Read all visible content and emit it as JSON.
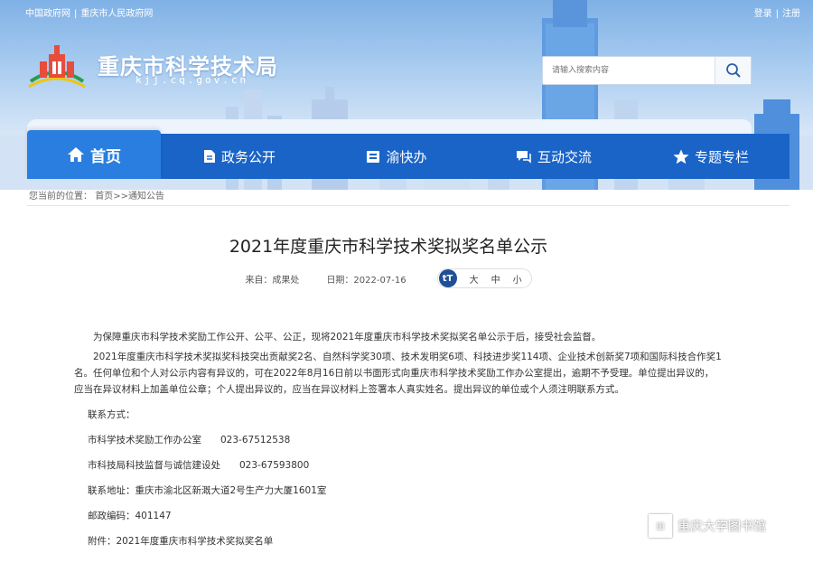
{
  "top_links": {
    "left": [
      "中国政府网",
      "重庆市人民政府网"
    ],
    "login": "登录",
    "register": "注册"
  },
  "site": {
    "title": "重庆市科学技术局",
    "domain": "kjj.cq.gov.cn"
  },
  "search": {
    "placeholder": "请输入搜索内容",
    "button_icon": "search-icon"
  },
  "nav": [
    {
      "label": "首页",
      "icon": "home-icon"
    },
    {
      "label": "政务公开",
      "icon": "document-icon"
    },
    {
      "label": "渝快办",
      "icon": "folder-icon"
    },
    {
      "label": "互动交流",
      "icon": "chat-icon"
    },
    {
      "label": "专题专栏",
      "icon": "star-icon"
    }
  ],
  "breadcrumb": {
    "prefix": "您当前的位置：",
    "home": "首页",
    "separator": ">>",
    "current": "通知公告"
  },
  "article": {
    "title": "2021年度重庆市科学技术奖拟奖名单公示",
    "source": "来自：成果处",
    "date": "日期：2022-07-16",
    "fontsize_icon": "tT",
    "fontsize_options": [
      "大",
      "中",
      "小"
    ],
    "paragraphs": [
      "为保障重庆市科学技术奖励工作公开、公平、公正，现将2021年度重庆市科学技术奖拟奖名单公示于后，接受社会监督。",
      "2021年度重庆市科学技术奖拟奖科技突出贡献奖2名、自然科学奖30项、技术发明奖6项、科技进步奖114项、企业技术创新奖7项和国际科技合作奖1名。任何单位和个人对公示内容有异议的，可在2022年8月16日前以书面形式向重庆市科学技术奖励工作办公室提出，逾期不予受理。单位提出异议的，应当在异议材料上加盖单位公章；个人提出异议的，应当在异议材料上签署本人真实姓名。提出异议的单位或个人须注明联系方式。"
    ],
    "contact_label": "联系方式：",
    "contacts": [
      "市科学技术奖励工作办公室　　023-67512538",
      "市科技局科技监督与诚信建设处　　023-67593800"
    ],
    "address": "联系地址：重庆市渝北区新溉大道2号生产力大厦1601室",
    "postcode": "邮政编码：401147",
    "attachment": "附件：2021年度重庆市科学技术奖拟奖名单"
  },
  "watermark": {
    "text": "重庆大学图书馆",
    "icon": "library-icon"
  }
}
